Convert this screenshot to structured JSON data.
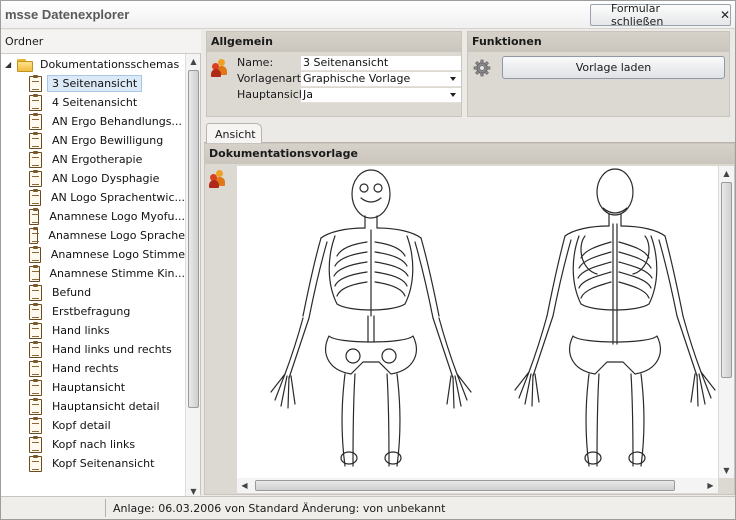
{
  "app": {
    "title": "msse Datenexplorer",
    "close_form_label": "Formular schließen"
  },
  "sidebar": {
    "header": "Ordner",
    "root": {
      "label": "Dokumentationsschemas",
      "expanded": true
    },
    "items": [
      {
        "label": "3 Seitenansicht",
        "selected": true
      },
      {
        "label": "4 Seitenansicht"
      },
      {
        "label": "AN Ergo Behandlungs..."
      },
      {
        "label": "AN Ergo Bewilligung"
      },
      {
        "label": "AN Ergotherapie"
      },
      {
        "label": "AN Logo Dysphagie"
      },
      {
        "label": "AN Logo Sprachentwic..."
      },
      {
        "label": "Anamnese Logo Myofu..."
      },
      {
        "label": "Anamnese Logo Sprache"
      },
      {
        "label": "Anamnese Logo Stimme"
      },
      {
        "label": "Anamnese Stimme Kin..."
      },
      {
        "label": "Befund"
      },
      {
        "label": "Erstbefragung"
      },
      {
        "label": "Hand links"
      },
      {
        "label": "Hand links und rechts"
      },
      {
        "label": "Hand rechts"
      },
      {
        "label": "Hauptansicht"
      },
      {
        "label": "Hauptansicht detail"
      },
      {
        "label": "Kopf detail"
      },
      {
        "label": "Kopf nach links"
      },
      {
        "label": "Kopf Seitenansicht"
      }
    ]
  },
  "allgemein": {
    "header": "Allgemein",
    "fields": {
      "name_label": "Name:",
      "name_value": "3 Seitenansicht",
      "vorlagenart_label": "Vorlagenart:",
      "vorlagenart_value": "Graphische Vorlage",
      "hauptansicht_label": "Hauptansicht",
      "hauptansicht_value": "Ja"
    }
  },
  "funktionen": {
    "header": "Funktionen",
    "load_button": "Vorlage laden"
  },
  "tabs": [
    {
      "label": "Ansicht",
      "active": true
    }
  ],
  "document": {
    "header": "Dokumentationsvorlage"
  },
  "status": {
    "text": "Anlage: 06.03.2006 von Standard  Änderung:  von unbekannt"
  },
  "colors": {
    "panel": "#dcd9d3",
    "header": "#cbc6bd",
    "selection": "#dce9f7"
  },
  "icons": {
    "folder": "folder-icon",
    "document": "clipboard-icon",
    "users": "users-icon",
    "gear": "gear-icon",
    "close": "close-icon"
  }
}
